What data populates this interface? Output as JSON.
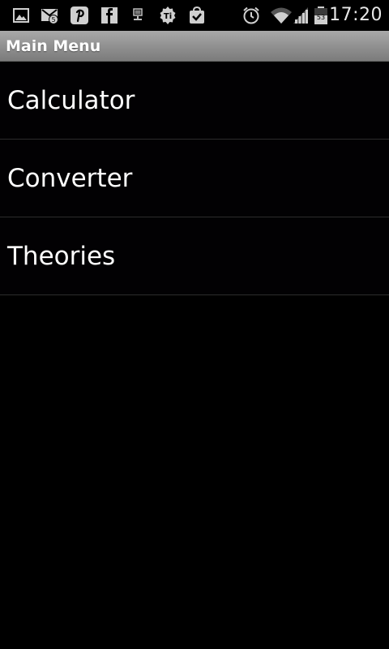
{
  "status_bar": {
    "time": "17:20",
    "notification_count": "5",
    "battery_level": "53",
    "icons": [
      "gallery-icon",
      "gmail-icon",
      "pinterest-icon",
      "facebook-icon",
      "usb-debug-icon",
      "ti-app-icon",
      "store-download-icon",
      "alarm-icon",
      "wifi-icon",
      "cell-signal-icon",
      "battery-icon"
    ]
  },
  "title_bar": {
    "title": "Main Menu"
  },
  "menu": {
    "items": [
      {
        "label": "Calculator"
      },
      {
        "label": "Converter"
      },
      {
        "label": "Theories"
      }
    ]
  },
  "colors": {
    "background": "#000000",
    "title_bar": "#8f8f8f",
    "divider": "#2c2c2c",
    "text": "#ffffff"
  }
}
